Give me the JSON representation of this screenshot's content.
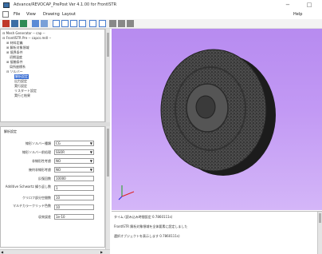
{
  "window": {
    "title": "Advance/REVOCAP_PrePost Ver 4.1.00 for FrontISTR",
    "minimize": "−",
    "maximize": "□"
  },
  "menu": {
    "file": "File",
    "view": "View",
    "drawing": "Drawing",
    "layout": "Layout",
    "help": "Help"
  },
  "tree": {
    "items": [
      "⊟ Mesh Generator -- cap --",
      "⊟ FrontISTR Pre -- capcs.mdl --",
      "⊞ 材料定義",
      "⊞ 解析対象領域",
      "⊞ 境界条件",
      "初期温度",
      "⊞ 接触条件",
      "局所座標系",
      "⊟ ソルバー",
      "解析設定",
      "出力設定",
      "実行設定",
      "リスタート設定",
      "実行と結果"
    ]
  },
  "props": {
    "title": "解析設定",
    "rows": [
      {
        "label": "線形ソルバー種類",
        "value": "CG"
      },
      {
        "label": "線形ソルバー前処理",
        "value": "SSOR"
      },
      {
        "label": "非線形性考慮",
        "value": "NO"
      },
      {
        "label": "幾何非線形考慮",
        "value": "NO"
      },
      {
        "label": "反復回数",
        "value": "10000"
      },
      {
        "label": "Additive Schwartz 繰り返し数",
        "value": "1"
      },
      {
        "label": "クリロフ部分空間数",
        "value": "10"
      },
      {
        "label": "マルチカラークリッド色数",
        "value": "10"
      },
      {
        "label": "収束誤差",
        "value": "1e-10"
      }
    ]
  },
  "log": {
    "lines": [
      "タイム (読み込み時間設定 0.7860111s)",
      "FrontISTR 解析対象領域を全体要素に設定しました",
      "選択オブジェクトを表示します 0.7860111s)"
    ]
  },
  "colors": {
    "viewport_top": "#b78bf0",
    "viewport_bottom": "#d4b6f8",
    "selection": "#3b6fd4",
    "mesh": "#2a2a2a"
  },
  "icons": [
    "new-icon",
    "open-icon",
    "save-icon",
    "view-icon",
    "grid-icon",
    "rotate-icon",
    "pan-icon",
    "zoom-icon",
    "fit-icon",
    "select-icon",
    "axis-icon"
  ]
}
